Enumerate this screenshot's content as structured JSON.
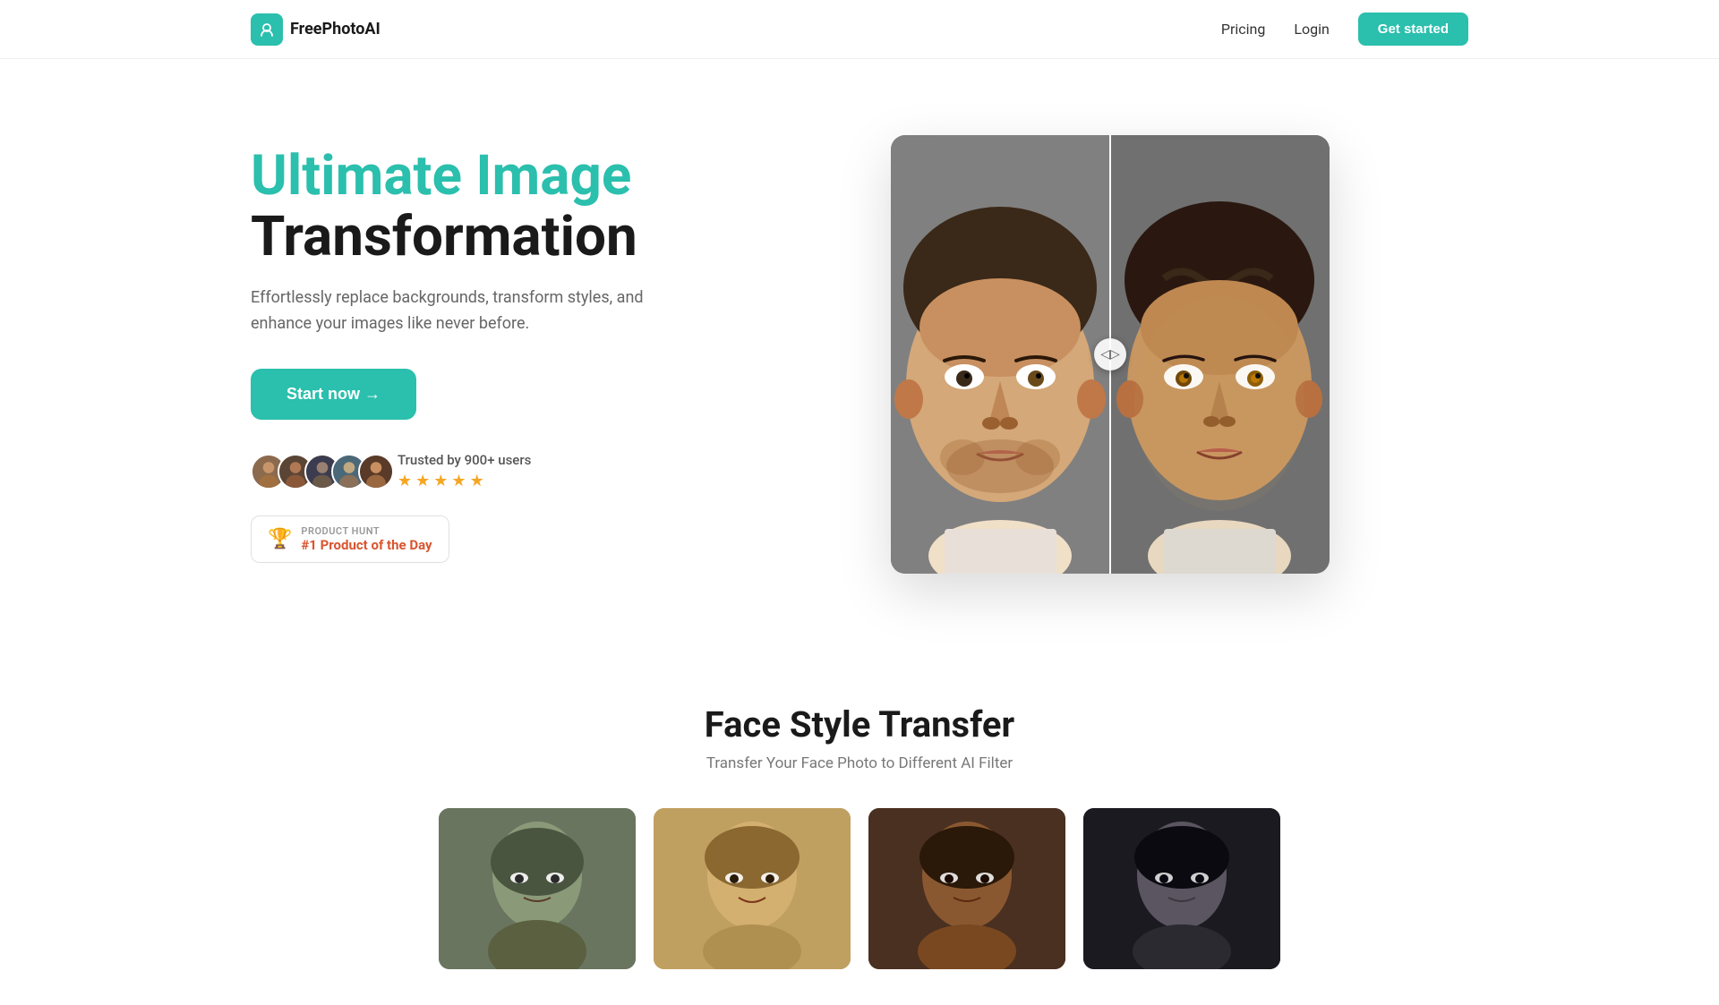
{
  "navbar": {
    "logo_text": "FreePhotoAI",
    "logo_icon": "✦",
    "nav_links": [
      {
        "label": "Pricing",
        "id": "pricing"
      },
      {
        "label": "Login",
        "id": "login"
      }
    ],
    "cta_label": "Get started"
  },
  "hero": {
    "title_line1": "Ultimate Image",
    "title_line2": "Transformation",
    "subtitle": "Effortlessly replace backgrounds, transform styles, and enhance your images like never before.",
    "cta_label": "Start now →",
    "trusted_text": "Trusted by 900+ users",
    "stars": [
      "★",
      "★",
      "★",
      "★",
      "★"
    ],
    "product_hunt": {
      "label": "PRODUCT HUNT",
      "title": "#1 Product of the Day"
    },
    "comparison_divider_icon": "◁▷"
  },
  "face_style_section": {
    "title": "Face Style Transfer",
    "subtitle": "Transfer Your Face Photo to Different AI Filter"
  },
  "colors": {
    "brand": "#2bbfad",
    "dark": "#1a1a1a",
    "gray": "#666666",
    "product_hunt": "#da552f",
    "star": "#f5a623"
  }
}
